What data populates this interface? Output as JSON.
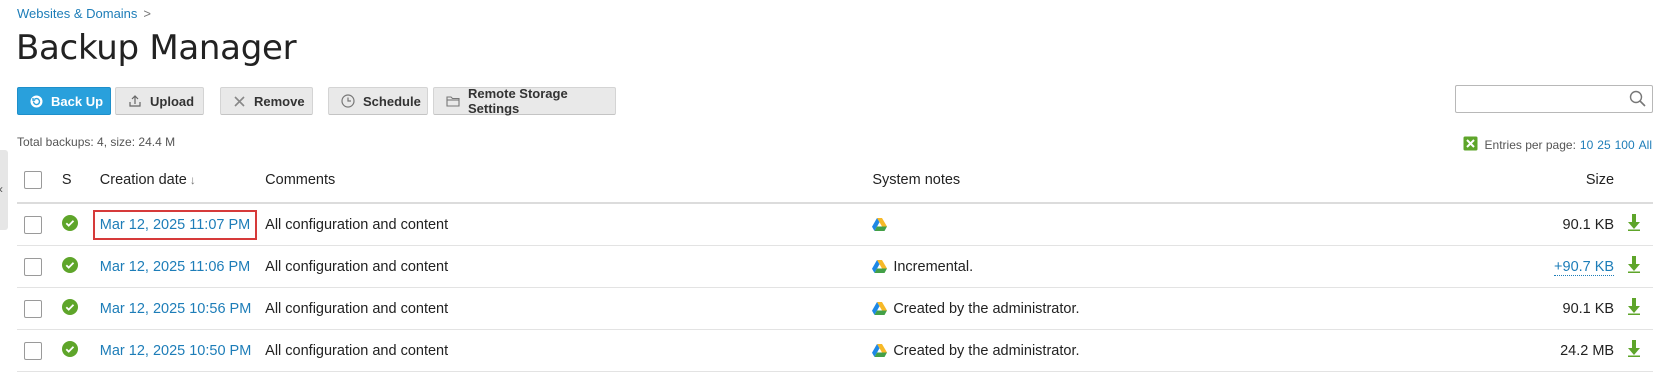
{
  "breadcrumb": {
    "label": "Websites & Domains",
    "separator": ">"
  },
  "page_title": "Backup Manager",
  "toolbar": {
    "backup": "Back Up",
    "upload": "Upload",
    "remove": "Remove",
    "schedule": "Schedule",
    "remote_storage": "Remote Storage Settings"
  },
  "search": {
    "placeholder": "",
    "value": ""
  },
  "totals": "Total backups: 4, size: 24.4 M",
  "pagination": {
    "label": "Entries per page:",
    "options": [
      "10",
      "25",
      "100",
      "All"
    ]
  },
  "table": {
    "headers": {
      "status": "S",
      "date": "Creation date",
      "sort_indicator": "↓",
      "comments": "Comments",
      "notes": "System notes",
      "size": "Size"
    },
    "rows": [
      {
        "date": "Mar 12, 2025 11:07 PM",
        "comment": "All configuration and content",
        "note": "",
        "size": "90.1 KB",
        "size_is_link": false
      },
      {
        "date": "Mar 12, 2025 11:06 PM",
        "comment": "All configuration and content",
        "note": "Incremental.",
        "size": "+90.7 KB",
        "size_is_link": true
      },
      {
        "date": "Mar 12, 2025 10:56 PM",
        "comment": "All configuration and content",
        "note": "Created by the administrator.",
        "size": "90.1 KB",
        "size_is_link": false
      },
      {
        "date": "Mar 12, 2025 10:50 PM",
        "comment": "All configuration and content",
        "note": "Created by the administrator.",
        "size": "24.2 MB",
        "size_is_link": false
      }
    ]
  },
  "colors": {
    "accent": "#29a0dc",
    "link": "#1d7db8",
    "status_ok": "#5ea52a",
    "download_arrow": "#5ea52a",
    "highlight": "#d63a3a"
  },
  "icons": {
    "status": "check-circle-icon",
    "storage": "google-drive-icon",
    "download": "download-arrow-icon",
    "export": "excel-export-icon"
  }
}
